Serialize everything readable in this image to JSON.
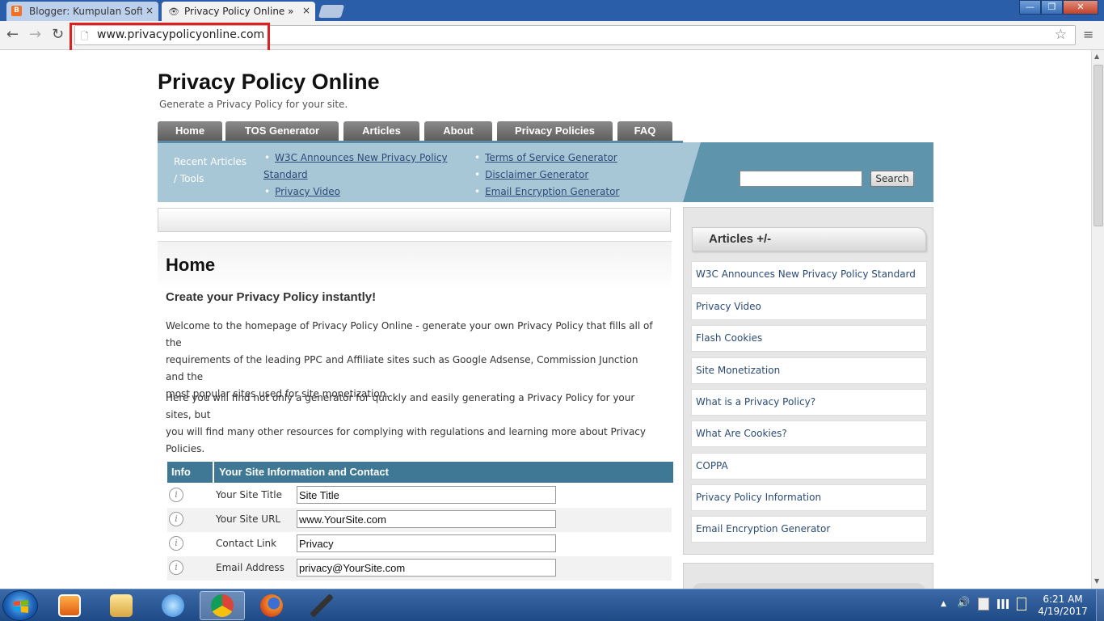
{
  "browser": {
    "tabs": [
      {
        "title": "Blogger: Kumpulan Softw",
        "close": "×"
      },
      {
        "title": "Privacy Policy Online » Pri",
        "close": "×"
      }
    ],
    "url": "www.privacypolicyonline.com",
    "back_icon": "←",
    "forward_icon": "→",
    "reload_icon": "↻",
    "star_icon": "☆",
    "menu_icon": "≡",
    "window_min": "—",
    "window_max": "❐",
    "window_close": "✕"
  },
  "site": {
    "title": "Privacy Policy Online",
    "tagline": "Generate a Privacy Policy for your site.",
    "nav": [
      "Home",
      "TOS Generator",
      "Articles",
      "About",
      "Privacy Policies",
      "FAQ"
    ],
    "recent": {
      "label_line1": "Recent Articles",
      "label_line2": "/ Tools",
      "links_left": [
        "W3C Announces New Privacy Policy",
        "Standard",
        "Privacy Video"
      ],
      "links_right": [
        "Terms of Service Generator",
        "Disclaimer Generator",
        "Email Encryption Generator"
      ]
    },
    "search_button": "Search"
  },
  "content": {
    "heading": "Home",
    "subheading": "Create your Privacy Policy instantly!",
    "para1_line1": "Welcome to the homepage of Privacy Policy Online - generate your own Privacy Policy that fills all of the",
    "para1_line2": "requirements of the leading PPC and Affiliate sites such as Google Adsense, Commission Junction and the",
    "para1_line3": "most popular sites used for site monetization.",
    "para2_line1": "Here you will find not only a generator for quickly and easily generating a Privacy Policy for your sites, but",
    "para2_line2": "you will find many other resources for complying with regulations and learning more about Privacy",
    "para2_line3": "Policies.",
    "table": {
      "col_info": "Info",
      "col_site": "Your Site Information and Contact",
      "info_glyph": "i",
      "rows": [
        {
          "label": "Your Site Title",
          "value": "Site Title"
        },
        {
          "label": "Your Site URL",
          "value": "www.YourSite.com"
        },
        {
          "label": "Contact Link",
          "value": "Privacy"
        },
        {
          "label": "Email Address",
          "value": "privacy@YourSite.com"
        }
      ]
    }
  },
  "sidebar": {
    "heading": "Articles +/-",
    "items": [
      "W3C Announces New Privacy Policy Standard",
      "Privacy Video",
      "Flash Cookies",
      "Site Monetization",
      "What is a Privacy Policy?",
      "What Are Cookies?",
      "COPPA",
      "Privacy Policy Information",
      "Email Encryption Generator"
    ]
  },
  "taskbar": {
    "time": "6:21 AM",
    "date": "4/19/2017",
    "apps": [
      "media-player",
      "file-explorer",
      "internet-explorer",
      "chrome",
      "firefox",
      "microphone"
    ],
    "tray_up": "▲",
    "tray_volume": "🔊"
  },
  "colors": {
    "nav_tab": "#5e5e5e",
    "recent_bar": "#a7c6d6",
    "search_bar": "#5e95ad",
    "table_header": "#3e7895",
    "link": "#2b4b78",
    "highlight": "#e02020"
  }
}
